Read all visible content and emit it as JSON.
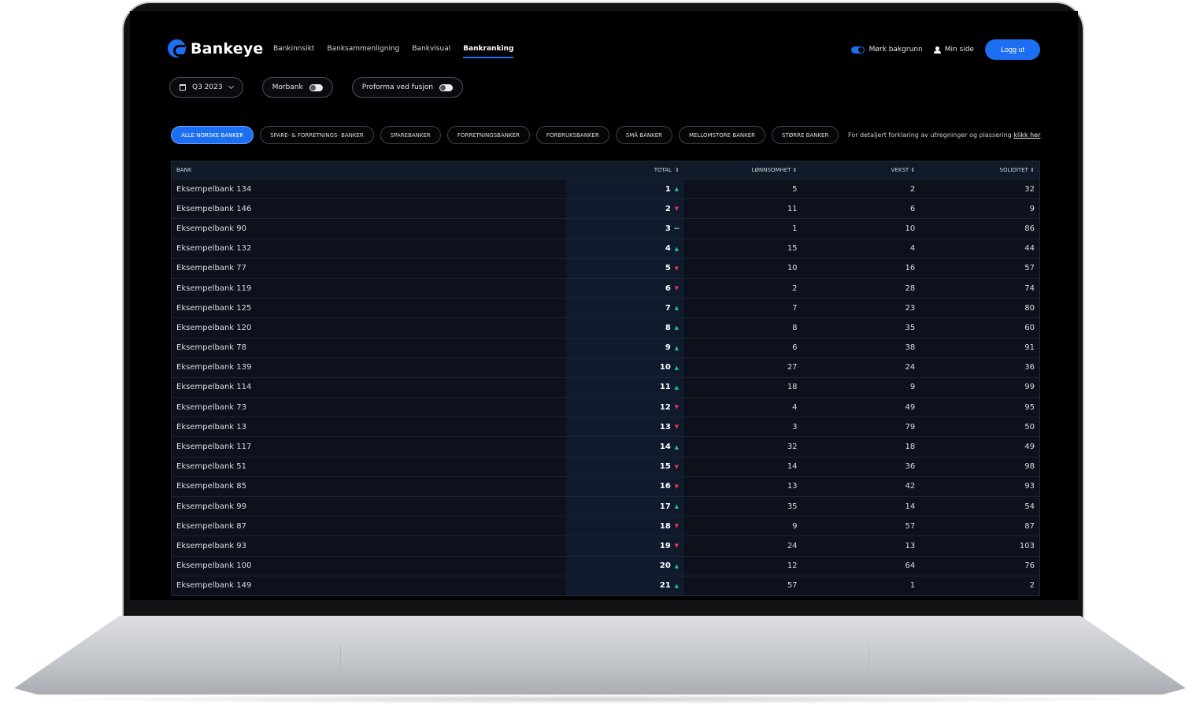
{
  "brand": {
    "name": "Bankeye"
  },
  "nav": {
    "items": [
      {
        "label": "Bankinnsikt"
      },
      {
        "label": "Banksammenligning"
      },
      {
        "label": "Bankvisual"
      },
      {
        "label": "Bankranking"
      }
    ],
    "active": "Bankranking",
    "dark_mode_label": "Mørk bakgrunn",
    "my_page_label": "Min side",
    "logout_label": "Logg ut"
  },
  "filters": {
    "period": "Q3 2023",
    "morbank_label": "Morbank",
    "proforma_label": "Proforma ved fusjon"
  },
  "categories": [
    {
      "label": "ALLE NORSKE BANKER"
    },
    {
      "label": "SPARE- & FORRETNINGS- BANKER"
    },
    {
      "label": "SPAREBANKER"
    },
    {
      "label": "FORRETNINGSBANKER"
    },
    {
      "label": "FORBRUKSBANKER"
    },
    {
      "label": "SMÅ BANKER"
    },
    {
      "label": "MELLOMSTORE BANKER"
    },
    {
      "label": "STØRRE BANKER"
    }
  ],
  "explain": {
    "text": "For detaljert forklaring av utregninger og plassering ",
    "link": "klikk her"
  },
  "table": {
    "headers": {
      "bank": "BANK",
      "total": "TOTAL",
      "profit": "LØNNSOMHET",
      "growth": "VEKST",
      "solidity": "SOLIDITET"
    },
    "sort_icon": "⇕",
    "rows": [
      {
        "bank": "Eksempelbank 134",
        "total": "1",
        "trend": "up",
        "profit": "5",
        "growth": "2",
        "solidity": "32"
      },
      {
        "bank": "Eksempelbank 146",
        "total": "2",
        "trend": "down",
        "profit": "11",
        "growth": "6",
        "solidity": "9"
      },
      {
        "bank": "Eksempelbank 90",
        "total": "3",
        "trend": "same",
        "profit": "1",
        "growth": "10",
        "solidity": "86"
      },
      {
        "bank": "Eksempelbank 132",
        "total": "4",
        "trend": "up",
        "profit": "15",
        "growth": "4",
        "solidity": "44"
      },
      {
        "bank": "Eksempelbank 77",
        "total": "5",
        "trend": "down",
        "profit": "10",
        "growth": "16",
        "solidity": "57"
      },
      {
        "bank": "Eksempelbank 119",
        "total": "6",
        "trend": "down",
        "profit": "2",
        "growth": "28",
        "solidity": "74"
      },
      {
        "bank": "Eksempelbank 125",
        "total": "7",
        "trend": "up",
        "profit": "7",
        "growth": "23",
        "solidity": "80"
      },
      {
        "bank": "Eksempelbank 120",
        "total": "8",
        "trend": "up",
        "profit": "8",
        "growth": "35",
        "solidity": "60"
      },
      {
        "bank": "Eksempelbank 78",
        "total": "9",
        "trend": "up",
        "profit": "6",
        "growth": "38",
        "solidity": "91"
      },
      {
        "bank": "Eksempelbank 139",
        "total": "10",
        "trend": "up",
        "profit": "27",
        "growth": "24",
        "solidity": "36"
      },
      {
        "bank": "Eksempelbank 114",
        "total": "11",
        "trend": "up",
        "profit": "18",
        "growth": "9",
        "solidity": "99"
      },
      {
        "bank": "Eksempelbank 73",
        "total": "12",
        "trend": "down",
        "profit": "4",
        "growth": "49",
        "solidity": "95"
      },
      {
        "bank": "Eksempelbank 13",
        "total": "13",
        "trend": "down",
        "profit": "3",
        "growth": "79",
        "solidity": "50"
      },
      {
        "bank": "Eksempelbank 117",
        "total": "14",
        "trend": "up",
        "profit": "32",
        "growth": "18",
        "solidity": "49"
      },
      {
        "bank": "Eksempelbank 51",
        "total": "15",
        "trend": "down",
        "profit": "14",
        "growth": "36",
        "solidity": "98"
      },
      {
        "bank": "Eksempelbank 85",
        "total": "16",
        "trend": "down",
        "profit": "13",
        "growth": "42",
        "solidity": "93"
      },
      {
        "bank": "Eksempelbank 99",
        "total": "17",
        "trend": "up",
        "profit": "35",
        "growth": "14",
        "solidity": "54"
      },
      {
        "bank": "Eksempelbank 87",
        "total": "18",
        "trend": "down",
        "profit": "9",
        "growth": "57",
        "solidity": "87"
      },
      {
        "bank": "Eksempelbank 93",
        "total": "19",
        "trend": "down",
        "profit": "24",
        "growth": "13",
        "solidity": "103"
      },
      {
        "bank": "Eksempelbank 100",
        "total": "20",
        "trend": "up",
        "profit": "12",
        "growth": "64",
        "solidity": "76"
      },
      {
        "bank": "Eksempelbank 149",
        "total": "21",
        "trend": "up",
        "profit": "57",
        "growth": "1",
        "solidity": "2"
      }
    ]
  },
  "colors": {
    "accent": "#1c6ef2",
    "up": "#22c37a",
    "down": "#e5384a",
    "background": "#000000"
  }
}
